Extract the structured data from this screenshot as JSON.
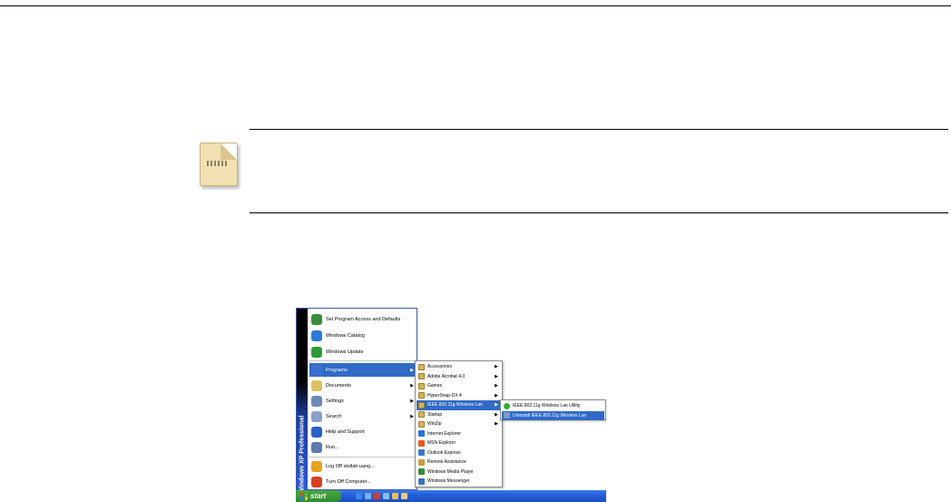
{
  "note": {
    "icon": "note-icon"
  },
  "start_menu": {
    "brand_text": "Windows XP Professional",
    "pinned": [
      {
        "label": "Set Program Access and Defaults",
        "icon": "program-access-icon",
        "color": "#3c8c3c"
      },
      {
        "label": "Windows Catalog",
        "icon": "windows-catalog-icon",
        "color": "#2b7ad6"
      },
      {
        "label": "Windows Update",
        "icon": "windows-update-icon",
        "color": "#2f9a3a"
      }
    ],
    "items": [
      {
        "label": "Programs",
        "icon": "programs-icon",
        "color": "#3b6fd0",
        "arrow": "▶",
        "highlighted": true
      },
      {
        "label": "Documents",
        "icon": "documents-icon",
        "color": "#e0c060",
        "arrow": "▶"
      },
      {
        "label": "Settings",
        "icon": "settings-icon",
        "color": "#6a8ab8",
        "arrow": "▶"
      },
      {
        "label": "Search",
        "icon": "search-icon",
        "color": "#8aa0c8",
        "arrow": "▶"
      },
      {
        "label": "Help and Support",
        "icon": "help-icon",
        "color": "#2a5fc8",
        "arrow": ""
      },
      {
        "label": "Run...",
        "icon": "run-icon",
        "color": "#5a7ab0",
        "arrow": ""
      }
    ],
    "bottom": [
      {
        "label": "Log Off stellah.uang...",
        "icon": "log-off-icon",
        "color": "#e8a020"
      },
      {
        "label": "Turn Off Computer...",
        "icon": "turn-off-icon",
        "color": "#d84020"
      }
    ]
  },
  "programs_menu": {
    "items": [
      {
        "label": "Accessories",
        "folder": true,
        "arrow": "▶"
      },
      {
        "label": "Adobe Acrobat 4.0",
        "folder": true,
        "arrow": "▶"
      },
      {
        "label": "Games",
        "folder": true,
        "arrow": "▶"
      },
      {
        "label": "HyperSnap-DX 4",
        "folder": true,
        "arrow": "▶"
      },
      {
        "label": "IEEE 802.11g Wireless Lan",
        "folder": true,
        "arrow": "▶",
        "highlighted": true
      },
      {
        "label": "Startup",
        "folder": true,
        "arrow": "▶"
      },
      {
        "label": "WinZip",
        "folder": true,
        "arrow": "▶"
      },
      {
        "label": "Internet Explorer",
        "folder": false,
        "arrow": "",
        "color": "#2a70d8"
      },
      {
        "label": "MSN Explorer",
        "folder": false,
        "arrow": "",
        "color": "#e85a20"
      },
      {
        "label": "Outlook Express",
        "folder": false,
        "arrow": "",
        "color": "#3a78c8"
      },
      {
        "label": "Remote Assistance",
        "folder": false,
        "arrow": "",
        "color": "#c89a40"
      },
      {
        "label": "Windows Media Player",
        "folder": false,
        "arrow": "",
        "color": "#3a8a3a"
      },
      {
        "label": "Windows Messenger",
        "folder": false,
        "arrow": "",
        "color": "#3a70c0"
      }
    ]
  },
  "wireless_menu": {
    "items": [
      {
        "label": "IEEE 802.11g Wireless Lan Utility",
        "color": "#2fb02f",
        "highlighted": false
      },
      {
        "label": "Uninstall IEEE 802.11g Wireless Lan",
        "color": "#7a9ac8",
        "highlighted": true
      }
    ]
  },
  "taskbar": {
    "start_label": "start",
    "quick_launch": [
      {
        "icon": "ie-quicklaunch-icon",
        "color": "#3a8ae8"
      },
      {
        "icon": "desktop-quicklaunch-icon",
        "color": "#7aaee8"
      },
      {
        "icon": "acrobat-quicklaunch-icon",
        "color": "#d83a2a"
      },
      {
        "icon": "media-quicklaunch-icon",
        "color": "#8ac0e8"
      },
      {
        "icon": "messenger-quicklaunch-icon",
        "color": "#e8c050"
      },
      {
        "icon": "folder-quicklaunch-icon",
        "color": "#e8d080"
      }
    ]
  }
}
